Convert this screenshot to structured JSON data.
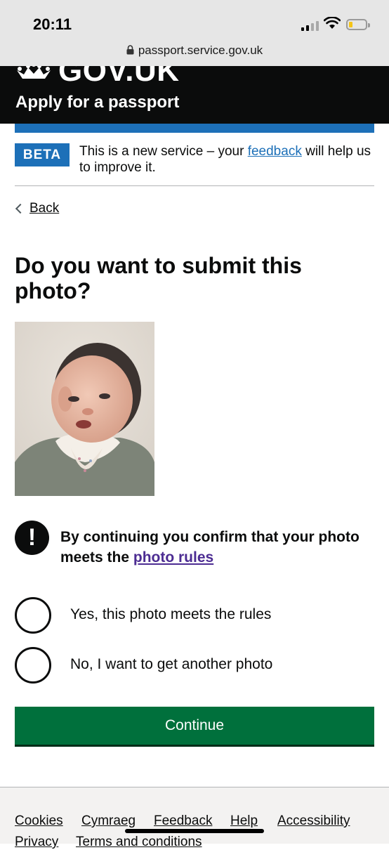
{
  "status_bar": {
    "time": "20:11",
    "url": "passport.service.gov.uk",
    "icons": [
      "signal-icon",
      "wifi-icon",
      "battery-icon",
      "lock-icon"
    ]
  },
  "header": {
    "logo_text": "GOV.UK",
    "service_name": "Apply for a passport"
  },
  "phase_banner": {
    "tag": "BETA",
    "text_before": "This is a new service – your ",
    "link": "feedback",
    "text_after": " will help us to improve it."
  },
  "back_link": "Back",
  "page_title": "Do you want to submit this photo?",
  "warning": {
    "text": "By continuing you confirm that your photo meets the ",
    "link": "photo rules",
    "icon": "!"
  },
  "options": [
    {
      "label": "Yes, this photo meets the rules",
      "selected": false
    },
    {
      "label": "No, I want to get another photo",
      "selected": false
    }
  ],
  "continue_label": "Continue",
  "footer": {
    "links": [
      "Cookies",
      "Cymraeg",
      "Feedback",
      "Help",
      "Accessibility",
      "Privacy",
      "Terms and conditions"
    ]
  },
  "colors": {
    "brand_blue": "#1d70b8",
    "header_black": "#0b0c0c",
    "button_green": "#00703c",
    "visited_link": "#4c2c92"
  }
}
